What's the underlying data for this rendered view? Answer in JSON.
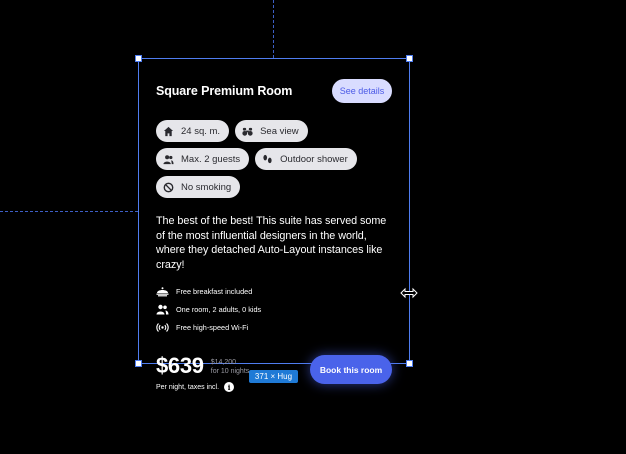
{
  "card": {
    "title": "Square Premium Room",
    "see_details": "See details",
    "features": [
      {
        "icon": "home-icon",
        "label": "24 sq. m."
      },
      {
        "icon": "binoculars-icon",
        "label": "Sea view"
      },
      {
        "icon": "guests-icon",
        "label": "Max. 2 guests"
      },
      {
        "icon": "footprints-icon",
        "label": "Outdoor shower"
      },
      {
        "icon": "no-smoking-icon",
        "label": "No smoking"
      }
    ],
    "description": "The best of the best! This suite has served some of the most influential designers in the world, where they detached Auto-Layout instances like crazy!",
    "amenities": [
      {
        "icon": "breakfast-icon",
        "label": "Free breakfast included"
      },
      {
        "icon": "people-icon",
        "label": "One room, 2 adults, 0 kids"
      },
      {
        "icon": "wifi-icon",
        "label": "Free high-speed Wi-Fi"
      }
    ],
    "price": "$639",
    "old_price": "$14,200",
    "nights": "for 10 nights",
    "price_note": "Per night, taxes incl.",
    "info_glyph": "i",
    "book_label": "Book this room"
  },
  "canvas": {
    "size_label": "371 × Hug"
  },
  "colors": {
    "accent": "#4a63ea",
    "details_bg": "#d9dcff",
    "chip_bg": "#e6e6ea",
    "selection": "#4f7df0"
  }
}
